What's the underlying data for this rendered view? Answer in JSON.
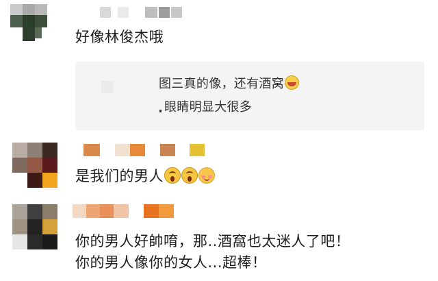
{
  "comments": [
    {
      "text": "好像林俊杰哦",
      "quote": {
        "line1": "图三真的像，还有酒窝",
        "line1_emoji": "laughing-tears-emoji",
        "line2": "眼睛明显大很多"
      }
    },
    {
      "text": "是我们的男人",
      "emojis": [
        "screaming-face-emoji",
        "screaming-face-emoji",
        "blushing-face-emoji"
      ]
    },
    {
      "lines": [
        "你的男人好帥唷，那..酒窩也太迷人了吧！",
        "你的男人像你的女人...超棒！"
      ]
    }
  ]
}
